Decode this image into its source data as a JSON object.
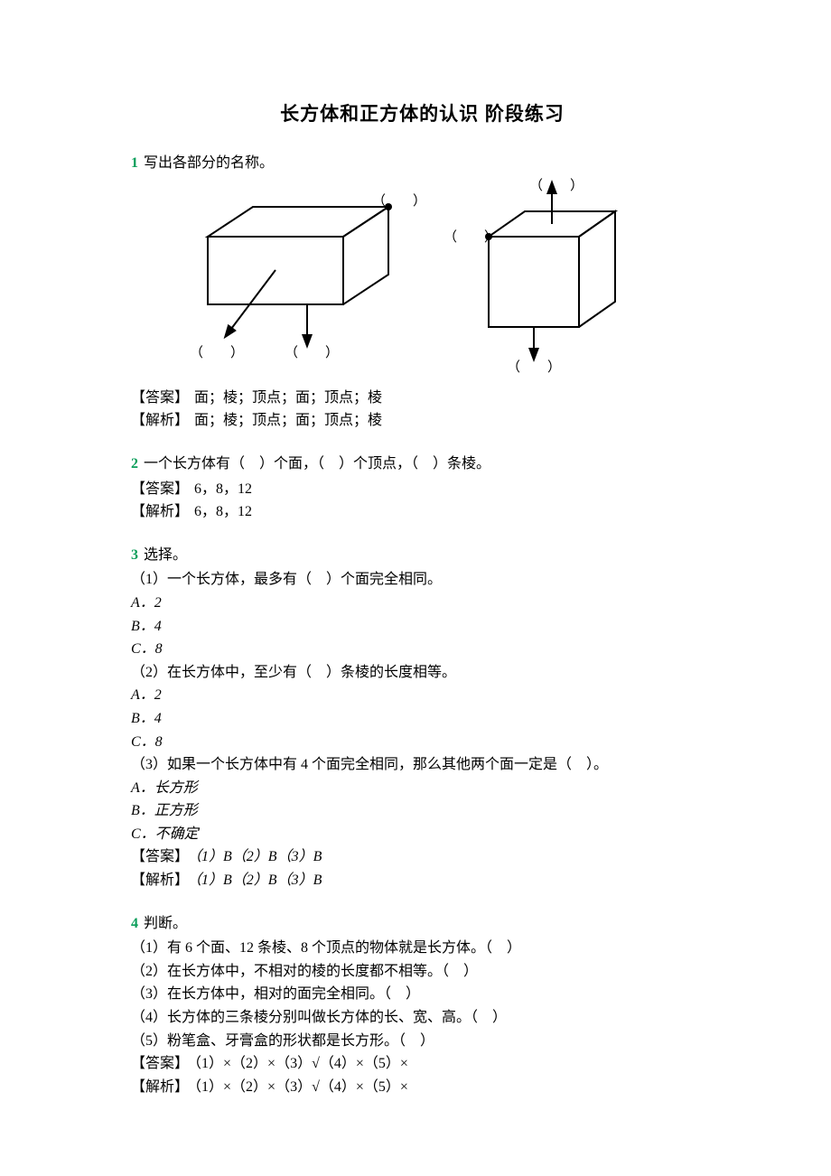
{
  "title": "长方体和正方体的认识 阶段练习",
  "q1": {
    "num": "1",
    "prompt": "写出各部分的名称。",
    "ans_label": "【答案】",
    "expl_label": "【解析】",
    "ans": "面；棱；顶点；面；顶点；棱",
    "expl": "面；棱；顶点；面；顶点；棱",
    "blanks": {
      "b1": "（　　）",
      "b2": "（　　）",
      "b3": "（　　）",
      "b4": "（　　）",
      "b5": "（　　）",
      "b6": "（　　）"
    }
  },
  "q2": {
    "num": "2",
    "prompt": "一个长方体有（　）个面，（　）个顶点，（　）条棱。",
    "ans_label": "【答案】",
    "expl_label": "【解析】",
    "ans": "6，8，12",
    "expl": "6，8，12"
  },
  "q3": {
    "num": "3",
    "prompt": "选择。",
    "p1": "（1）一个长方体，最多有（　）个面完全相同。",
    "p2": "（2）在长方体中，至少有（　）条棱的长度相等。",
    "p3": "（3）如果一个长方体中有 4 个面完全相同，那么其他两个面一定是（　）。",
    "a1": "A．2",
    "b1": "B．4",
    "c1": "C．8",
    "a2": "A．2",
    "b2": "B．4",
    "c2": "C．8",
    "a3": "A．长方形",
    "b3": "B．正方形",
    "c3": "C．不确定",
    "ans_label": "【答案】",
    "expl_label": "【解析】",
    "ans": "（1）B（2）B（3）B",
    "expl": "（1）B（2）B（3）B"
  },
  "q4": {
    "num": "4",
    "prompt": "判断。",
    "p1": "（1）有 6 个面、12 条棱、8 个顶点的物体就是长方体。（　）",
    "p2": "（2）在长方体中，不相对的棱的长度都不相等。（　）",
    "p3": "（3）在长方体中，相对的面完全相同。（　）",
    "p4": "（4）长方体的三条棱分别叫做长方体的长、宽、高。（　）",
    "p5": "（5）粉笔盒、牙膏盒的形状都是长方形。（　）",
    "ans_label": "【答案】",
    "expl_label": "【解析】",
    "ans": "（1）×（2）×（3）√（4）×（5）×",
    "expl": "（1）×（2）×（3）√（4）×（5）×"
  }
}
